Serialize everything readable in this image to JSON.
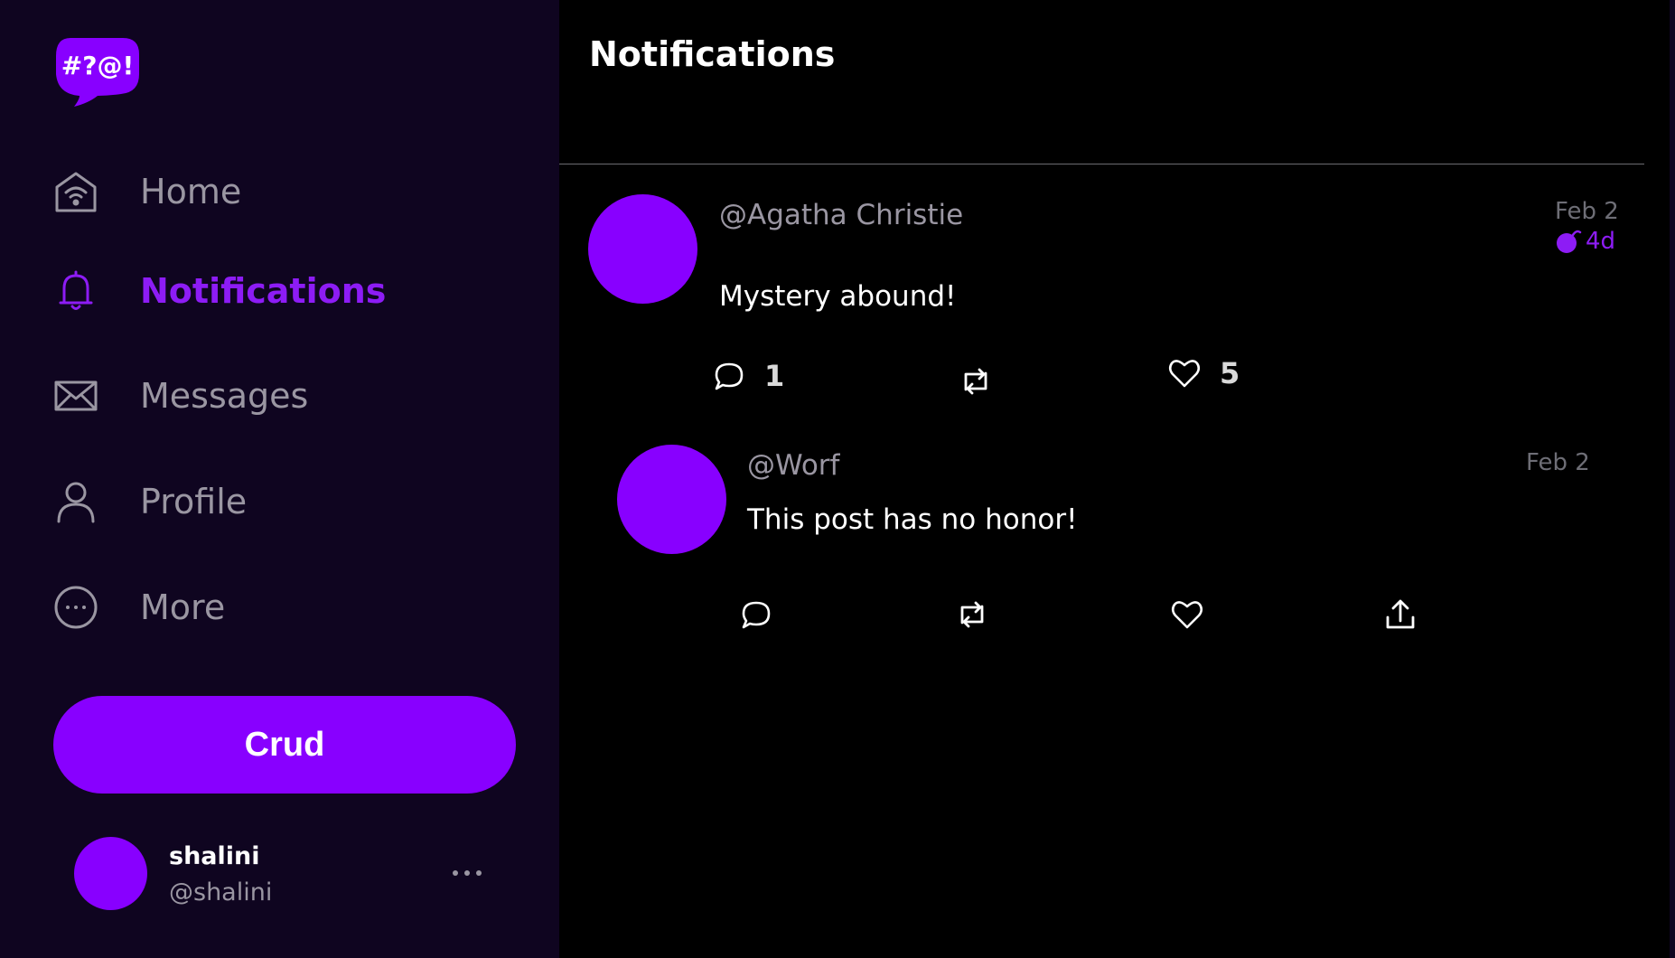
{
  "app": {
    "logo_text": "#?@!"
  },
  "sidebar": {
    "items": [
      {
        "label": "Home",
        "icon": "home-wifi-icon",
        "active": false
      },
      {
        "label": "Notifications",
        "icon": "bell-icon",
        "active": true
      },
      {
        "label": "Messages",
        "icon": "envelope-icon",
        "active": false
      },
      {
        "label": "Profile",
        "icon": "user-icon",
        "active": false
      },
      {
        "label": "More",
        "icon": "more-circle-icon",
        "active": false
      }
    ],
    "post_button_label": "Crud",
    "account": {
      "name": "shalini",
      "handle": "@shalini"
    }
  },
  "main": {
    "title": "Notifications",
    "posts": [
      {
        "handle": "@Agatha Christie",
        "date": "Feb 2",
        "age": "4d",
        "text": "Mystery abound!",
        "reply_count": "1",
        "like_count": "5"
      },
      {
        "handle": "@Worf",
        "date": "Feb 2",
        "text": "This post has no honor!"
      }
    ]
  },
  "colors": {
    "accent": "#8800ff",
    "accent_text": "#8d1cf5",
    "sidebar_bg": "#0f0520",
    "main_bg": "#000000",
    "muted_text": "#9a96a2"
  }
}
